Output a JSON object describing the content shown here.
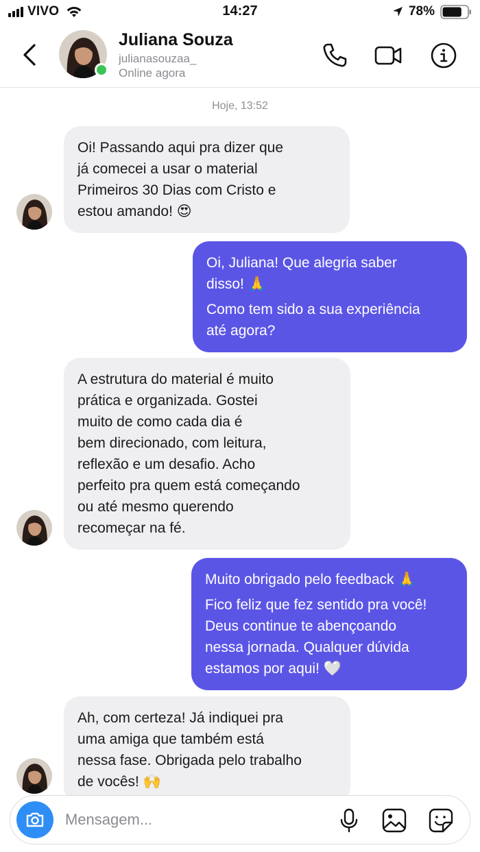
{
  "status_bar": {
    "carrier": "VIVO",
    "time": "14:27",
    "battery_percent": "78%",
    "battery_level": 0.78,
    "icons": [
      "signal-icon",
      "wifi-icon",
      "location-arrow-icon",
      "battery-icon"
    ]
  },
  "header": {
    "name": "Juliana Souza",
    "handle": "julianasouzaa_",
    "status": "Online agora",
    "icons": [
      "back-chevron-icon",
      "phone-icon",
      "video-camera-icon",
      "info-icon"
    ]
  },
  "chat": {
    "date_separator": "Hoje, 13:52",
    "messages": [
      {
        "direction": "incoming",
        "paragraphs": [
          [
            "Oi! Passando aqui pra dizer que",
            "já comecei a usar o material",
            "Primeiros 30 Dias com Cristo e",
            "estou amando! 😍"
          ]
        ]
      },
      {
        "direction": "outgoing",
        "paragraphs": [
          [
            "Oi, Juliana! Que alegria saber",
            "disso! 🙏"
          ],
          [
            "Como tem sido a sua experiência",
            "até agora?"
          ]
        ]
      },
      {
        "direction": "incoming",
        "paragraphs": [
          [
            "A estrutura do material é muito",
            "prática e organizada. Gostei",
            "muito de como cada dia é",
            "bem direcionado, com leitura,",
            "reflexão e um desafio. Acho",
            "perfeito pra quem está começando",
            "ou até mesmo querendo",
            "recomeçar na fé."
          ]
        ]
      },
      {
        "direction": "outgoing",
        "paragraphs": [
          [
            "Muito obrigado pelo feedback 🙏"
          ],
          [
            "Fico feliz que fez sentido pra você!",
            "Deus continue te abençoando",
            "nessa jornada. Qualquer dúvida",
            "estamos por aqui! 🤍"
          ]
        ]
      },
      {
        "direction": "incoming",
        "paragraphs": [
          [
            "Ah, com certeza! Já indiquei pra",
            "uma amiga que também está",
            "nessa fase. Obrigada pelo trabalho",
            "de vocês! 🙌"
          ]
        ]
      }
    ]
  },
  "composer": {
    "placeholder": "Mensagem...",
    "icons": [
      "camera-icon",
      "microphone-icon",
      "gallery-icon",
      "sticker-icon"
    ]
  },
  "colors": {
    "outgoing_bubble": "#5b55e6",
    "incoming_bubble": "#efeff2",
    "online_dot": "#3cc556",
    "camera_button": "#2f8ef5"
  }
}
